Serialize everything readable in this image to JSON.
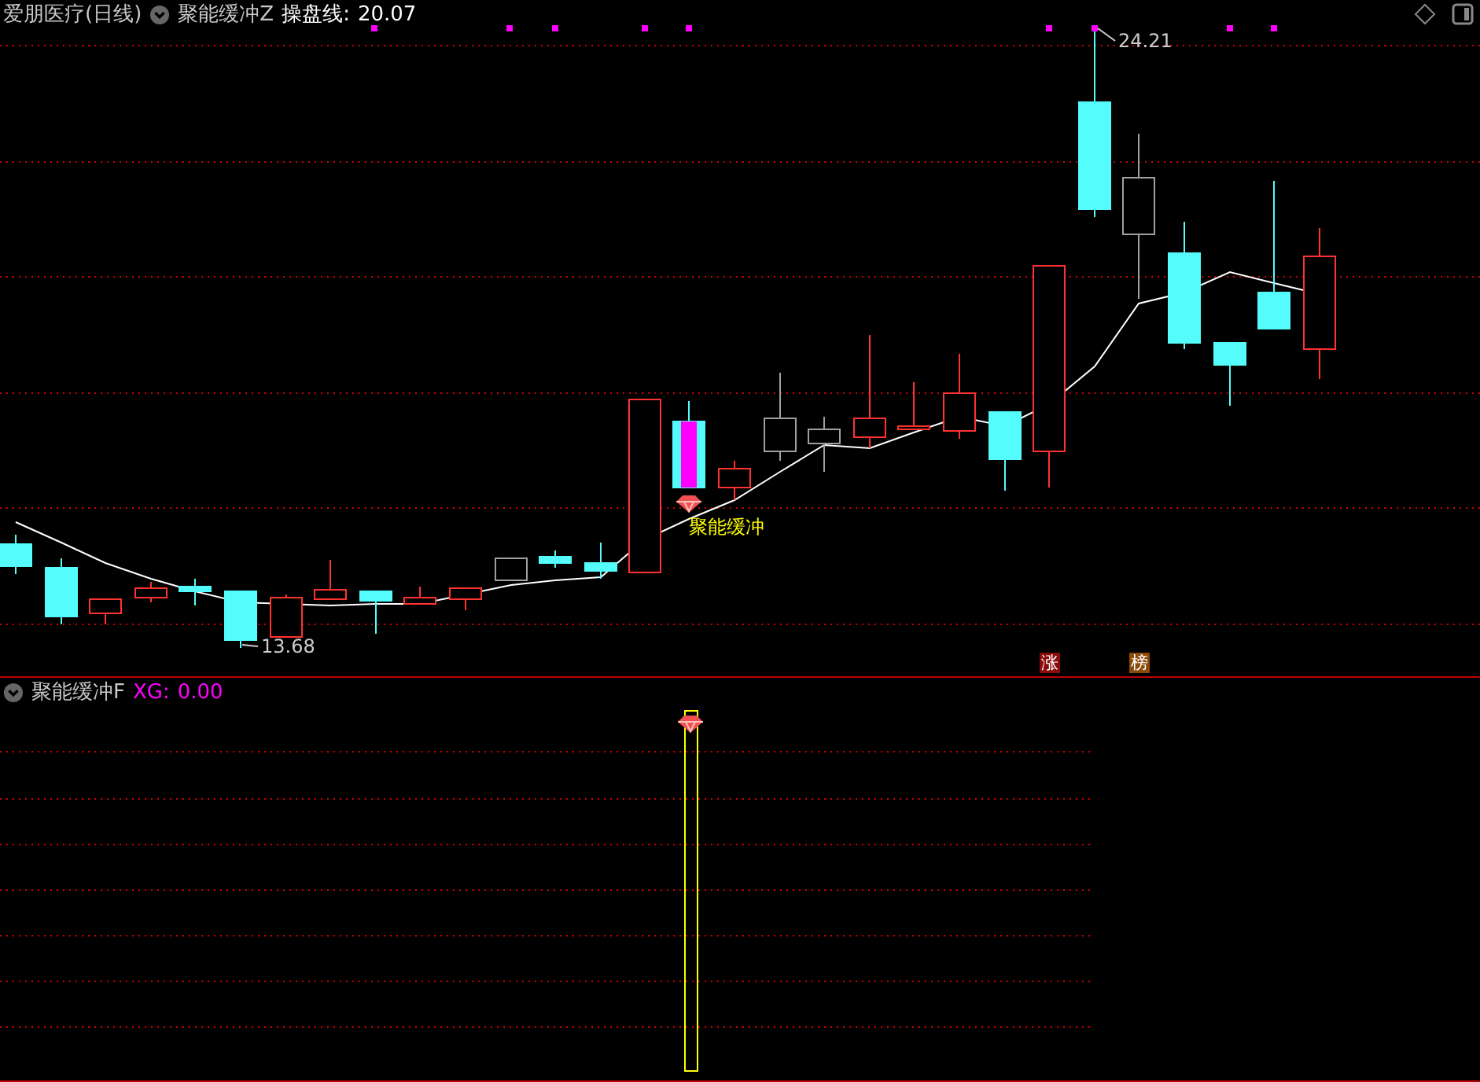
{
  "header": {
    "stock": "爱朋医疗(日线)",
    "indicator": "聚能缓冲Z",
    "line_label": "操盘线:",
    "line_value": "20.07"
  },
  "price_labels": [
    {
      "kind": "high",
      "text": "24.21"
    },
    {
      "kind": "low",
      "text": "13.68"
    }
  ],
  "signal_label": "聚能缓冲",
  "badges": [
    {
      "text": "涨",
      "color": "#8b0a0a"
    },
    {
      "text": "榜",
      "color": "#8b4a0a"
    }
  ],
  "lower_panel": {
    "indicator": "聚能缓冲F",
    "xg_label": "XG:",
    "xg_value": "0.00"
  }
}
